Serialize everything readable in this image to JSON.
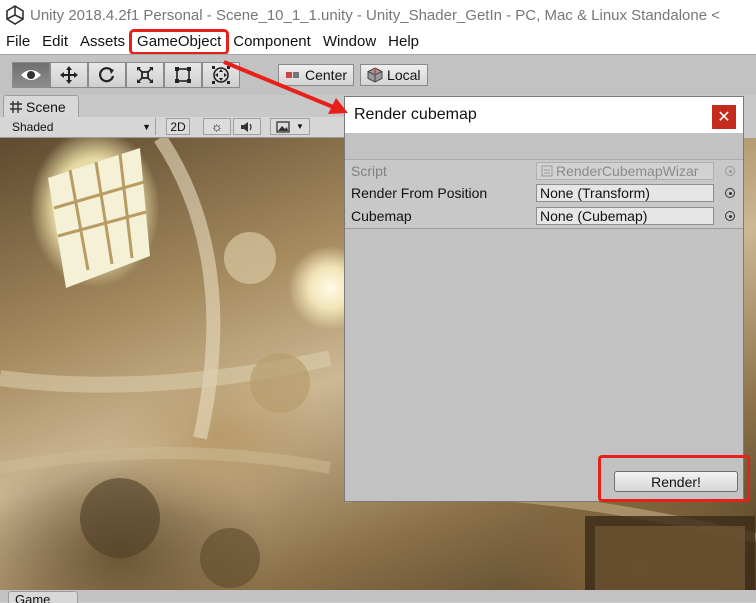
{
  "window": {
    "title": "Unity 2018.4.2f1 Personal - Scene_10_1_1.unity - Unity_Shader_GetIn - PC, Mac & Linux Standalone <"
  },
  "menubar": {
    "items": [
      "File",
      "Edit",
      "Assets",
      "GameObject",
      "Component",
      "Window",
      "Help"
    ],
    "highlighted": "GameObject"
  },
  "toolbar": {
    "tools": [
      "eye-icon",
      "move-icon",
      "rotate-icon",
      "scale-icon",
      "rect-icon",
      "transform-icon"
    ],
    "pivot_label": "Center",
    "space_label": "Local"
  },
  "scene_tab": {
    "label": "Scene"
  },
  "scene_toolbar": {
    "shading": "Shaded",
    "mode_2d": "2D"
  },
  "game_tab": {
    "label": "Game"
  },
  "dialog": {
    "title": "Render cubemap",
    "close_icon": "close-icon",
    "fields": [
      {
        "label": "Script",
        "value": "RenderCubemapWizar",
        "disabled": true
      },
      {
        "label": "Render From Position",
        "value": "None (Transform)",
        "disabled": false
      },
      {
        "label": "Cubemap",
        "value": "None (Cubemap)",
        "disabled": false
      }
    ],
    "button_label": "Render!"
  },
  "colors": {
    "highlight": "#e8201a",
    "close_button": "#c42b1c",
    "toolbar_bg": "#c2c2c2"
  }
}
